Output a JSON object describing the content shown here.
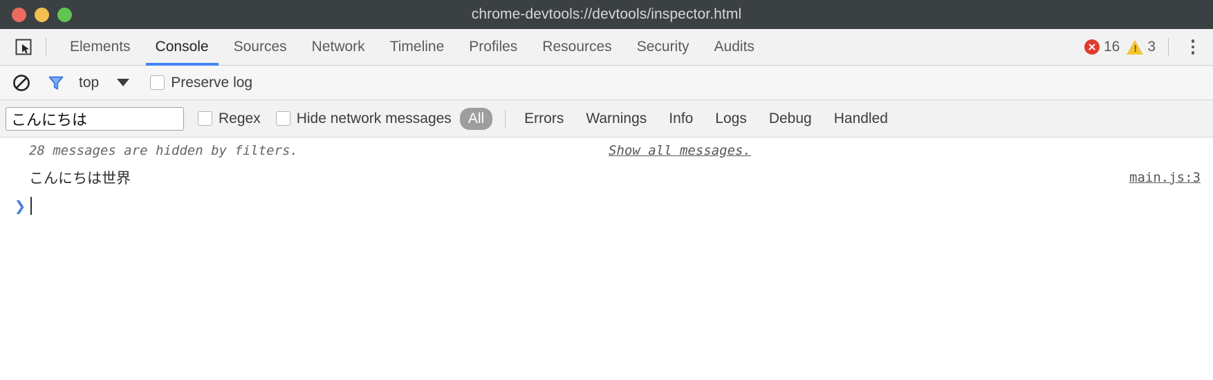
{
  "window": {
    "title": "chrome-devtools://devtools/inspector.html",
    "controls": [
      {
        "name": "close",
        "color": "#ed6a5e"
      },
      {
        "name": "minimize",
        "color": "#f4bf4f"
      },
      {
        "name": "zoom",
        "color": "#61c554"
      }
    ]
  },
  "tabbar": {
    "inspect_icon": "inspect-element-icon",
    "tabs": [
      {
        "label": "Elements",
        "active": false
      },
      {
        "label": "Console",
        "active": true
      },
      {
        "label": "Sources",
        "active": false
      },
      {
        "label": "Network",
        "active": false
      },
      {
        "label": "Timeline",
        "active": false
      },
      {
        "label": "Profiles",
        "active": false
      },
      {
        "label": "Resources",
        "active": false
      },
      {
        "label": "Security",
        "active": false
      },
      {
        "label": "Audits",
        "active": false
      }
    ],
    "error_icon": "error-circle-icon",
    "error_count": "16",
    "warning_icon": "warning-triangle-icon",
    "warning_count": "3",
    "warning_glyph": "!",
    "more_icon": "vertical-dots-icon",
    "active_tab_color": "#4285f4",
    "error_color": "#df3c30",
    "warning_color": "#f5c431"
  },
  "toolbar": {
    "clear_icon": "clear-console-icon",
    "filter_icon": "filter-funnel-icon",
    "filter_icon_color": "#4a90e2",
    "context_label": "top",
    "context_caret_icon": "chevron-down-icon",
    "preserve_log_label": "Preserve log",
    "preserve_log_checked": false
  },
  "filterbar": {
    "filter_value": "こんにちは",
    "filter_placeholder": "Filter",
    "regex_label": "Regex",
    "regex_checked": false,
    "hide_network_label": "Hide network messages",
    "hide_network_checked": false,
    "levels": [
      {
        "label": "All",
        "selected": true
      },
      {
        "label": "Errors",
        "selected": false
      },
      {
        "label": "Warnings",
        "selected": false
      },
      {
        "label": "Info",
        "selected": false
      },
      {
        "label": "Logs",
        "selected": false
      },
      {
        "label": "Debug",
        "selected": false
      },
      {
        "label": "Handled",
        "selected": false
      }
    ],
    "selected_pill_color": "#9e9e9e"
  },
  "console": {
    "hidden_message": "28 messages are hidden by filters.",
    "show_all_link": "Show all messages.",
    "message_text": "こんにちは世界",
    "message_source": "main.js:3",
    "prompt_symbol": "❯",
    "prompt_value": ""
  }
}
